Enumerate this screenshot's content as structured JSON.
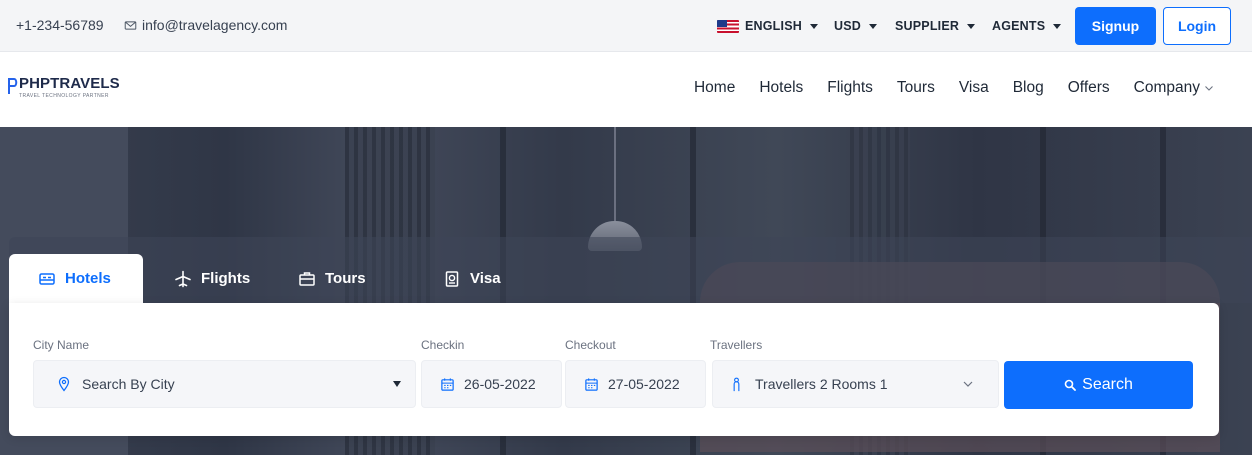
{
  "topbar": {
    "phone": "+1-234-56789",
    "email": "info@travelagency.com",
    "language": "ENGLISH",
    "currency": "USD",
    "supplier": "SUPPLIER",
    "agents": "AGENTS",
    "signup_label": "Signup",
    "login_label": "Login"
  },
  "brand": {
    "name": "PHPTRAVELS",
    "tagline": "TRAVEL TECHNOLOGY PARTNER"
  },
  "nav": {
    "items": [
      "Home",
      "Hotels",
      "Flights",
      "Tours",
      "Visa",
      "Blog",
      "Offers",
      "Company"
    ]
  },
  "search": {
    "tabs": [
      {
        "label": "Hotels",
        "icon": "hotel-icon"
      },
      {
        "label": "Flights",
        "icon": "plane-icon"
      },
      {
        "label": "Tours",
        "icon": "suitcase-icon"
      },
      {
        "label": "Visa",
        "icon": "passport-icon"
      }
    ],
    "active_tab": "Hotels",
    "city_label": "City Name",
    "city_value": "Search By City",
    "checkin_label": "Checkin",
    "checkin_value": "26-05-2022",
    "checkout_label": "Checkout",
    "checkout_value": "27-05-2022",
    "travellers_label": "Travellers",
    "travellers_value": "Travellers 2 Rooms 1",
    "search_label": "Search"
  },
  "colors": {
    "primary": "#0d6efd",
    "topbar_bg": "#f4f5f7",
    "hero_bg": "#3a4151"
  }
}
